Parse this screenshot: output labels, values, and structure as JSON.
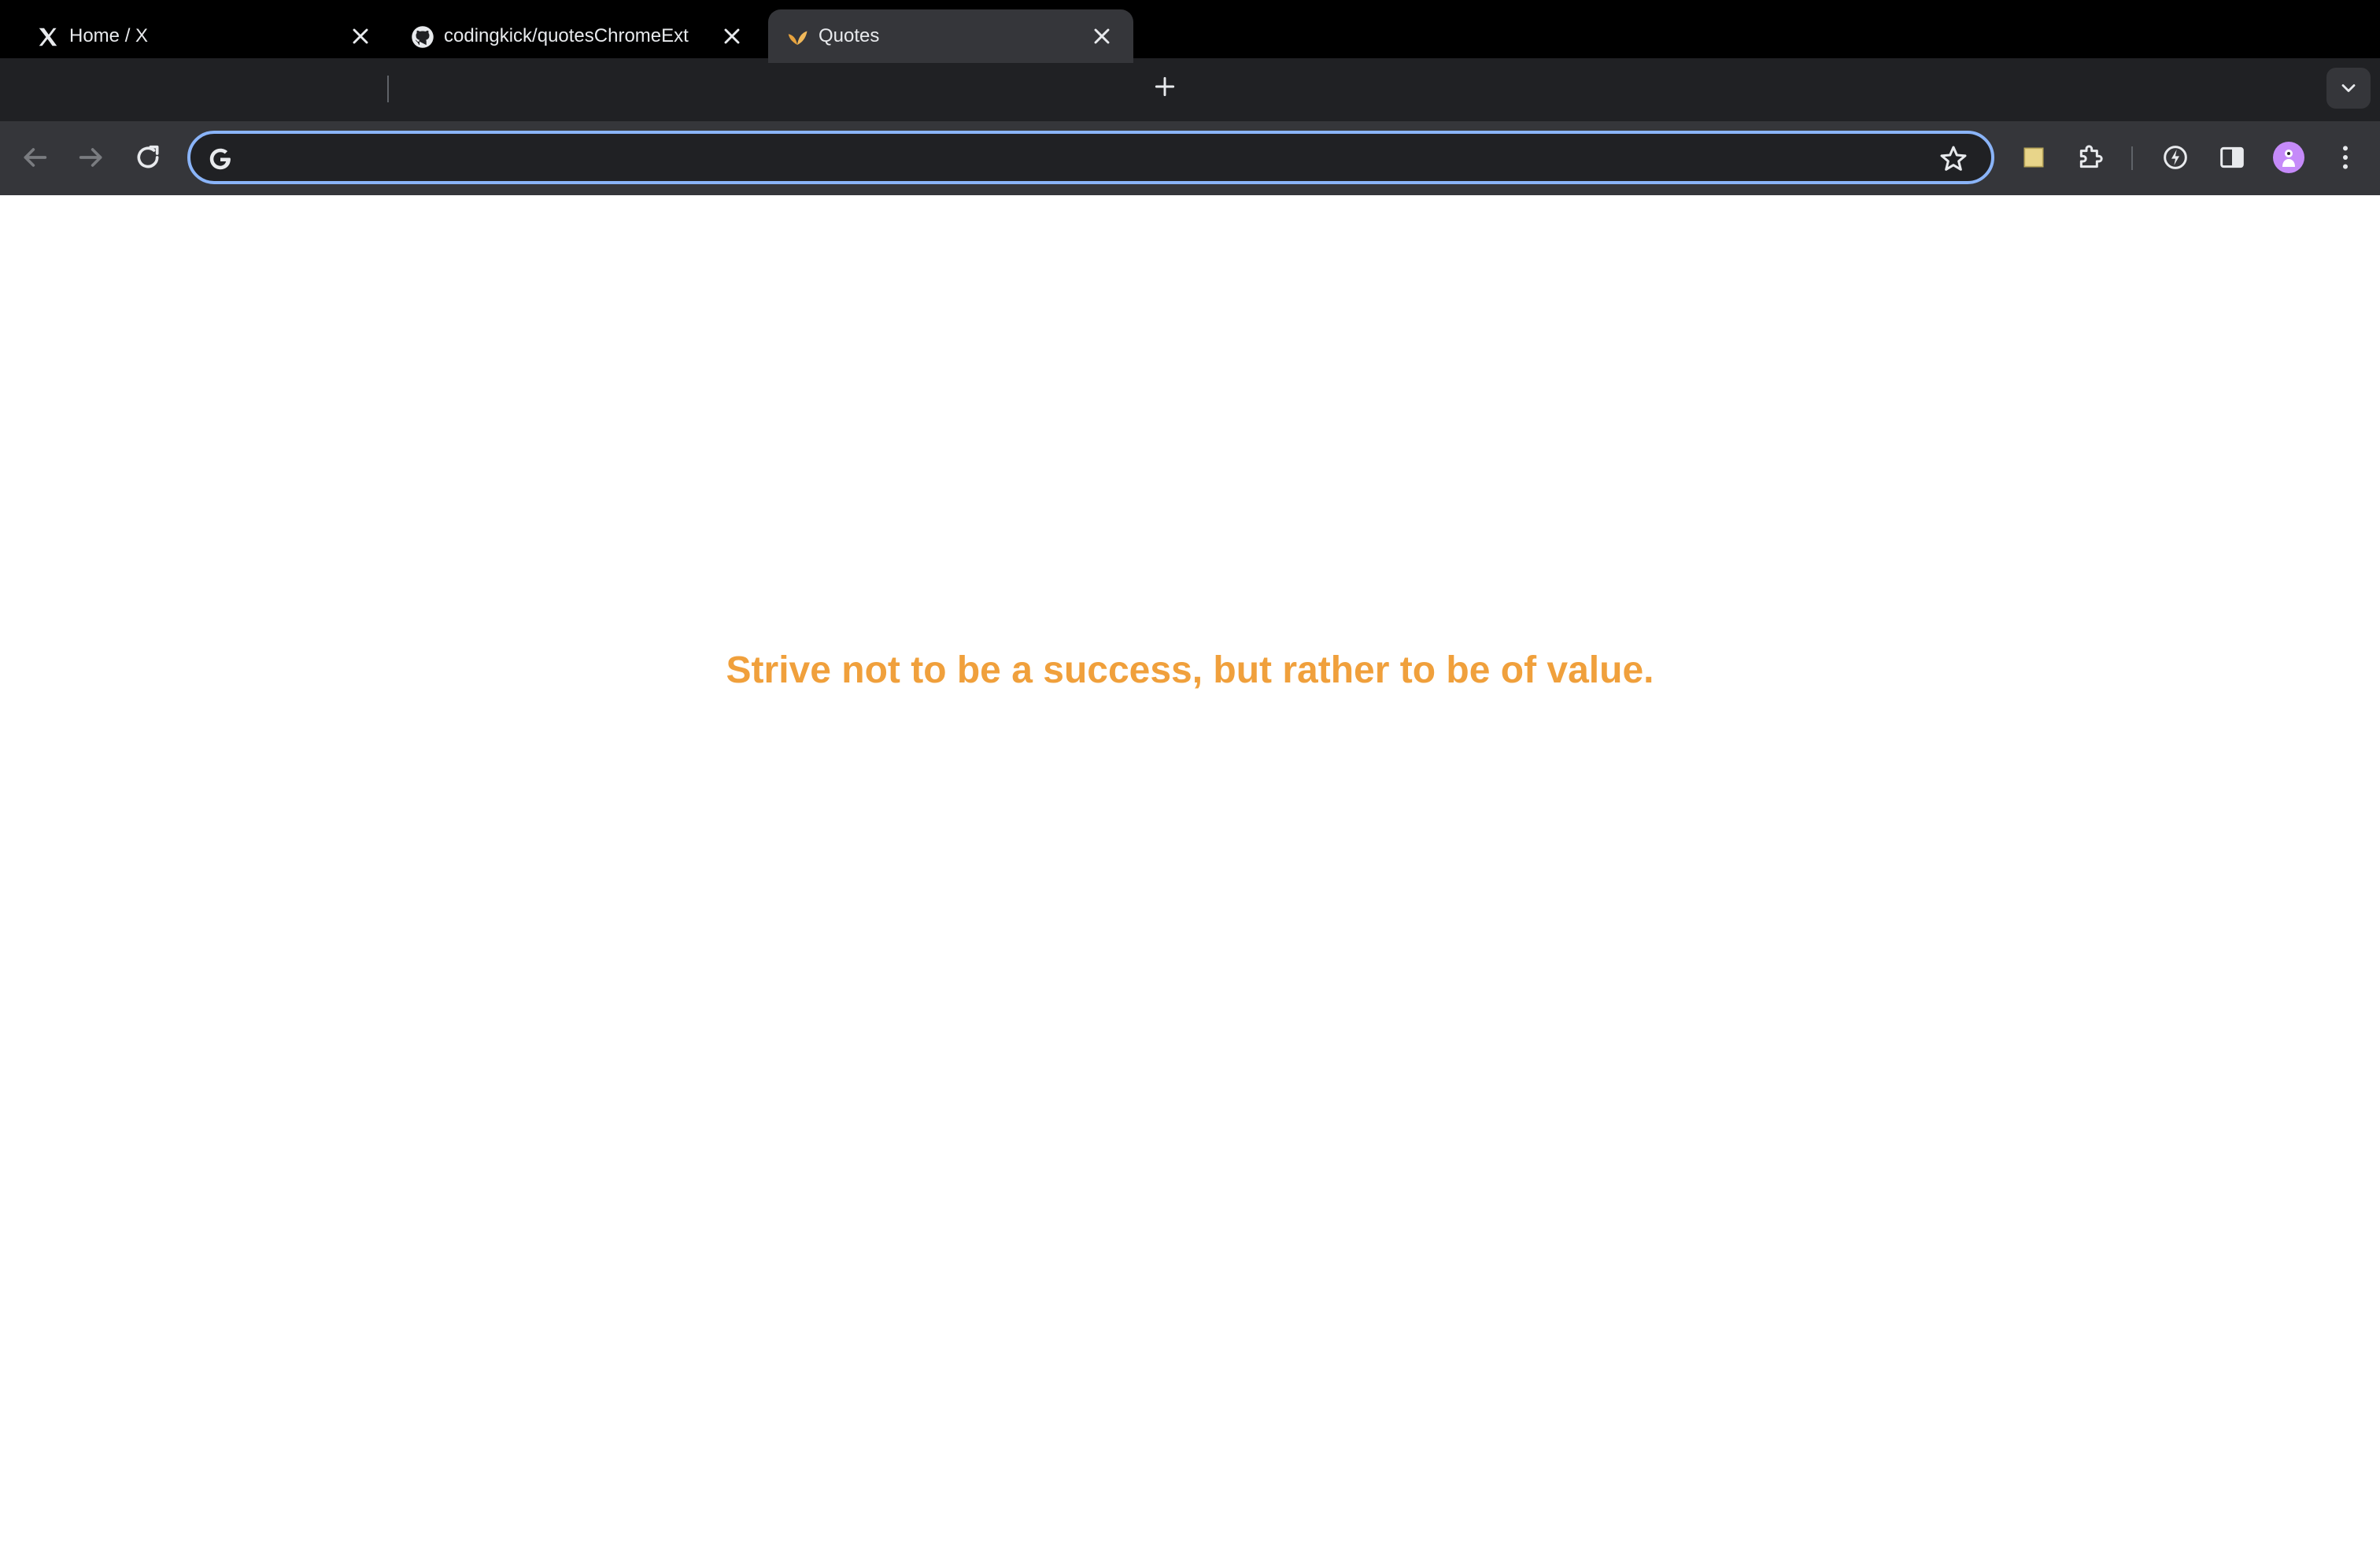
{
  "browser": {
    "tabs": [
      {
        "title": "Home / X",
        "favicon": "x-logo-icon",
        "active": false
      },
      {
        "title": "codingkick/quotesChromeExt",
        "favicon": "github-icon",
        "active": false
      },
      {
        "title": "Quotes",
        "favicon": "leaf-icon",
        "active": true
      }
    ],
    "address_bar": {
      "value": "",
      "placeholder": ""
    },
    "colors": {
      "tabstrip": "#202124",
      "toolbar": "#35363a",
      "focus_ring": "#8ab4f8",
      "profile": "#c58af9"
    }
  },
  "page": {
    "quote": "Strive not to be a success, but rather to be of value.",
    "quote_color": "#f0a03c"
  }
}
